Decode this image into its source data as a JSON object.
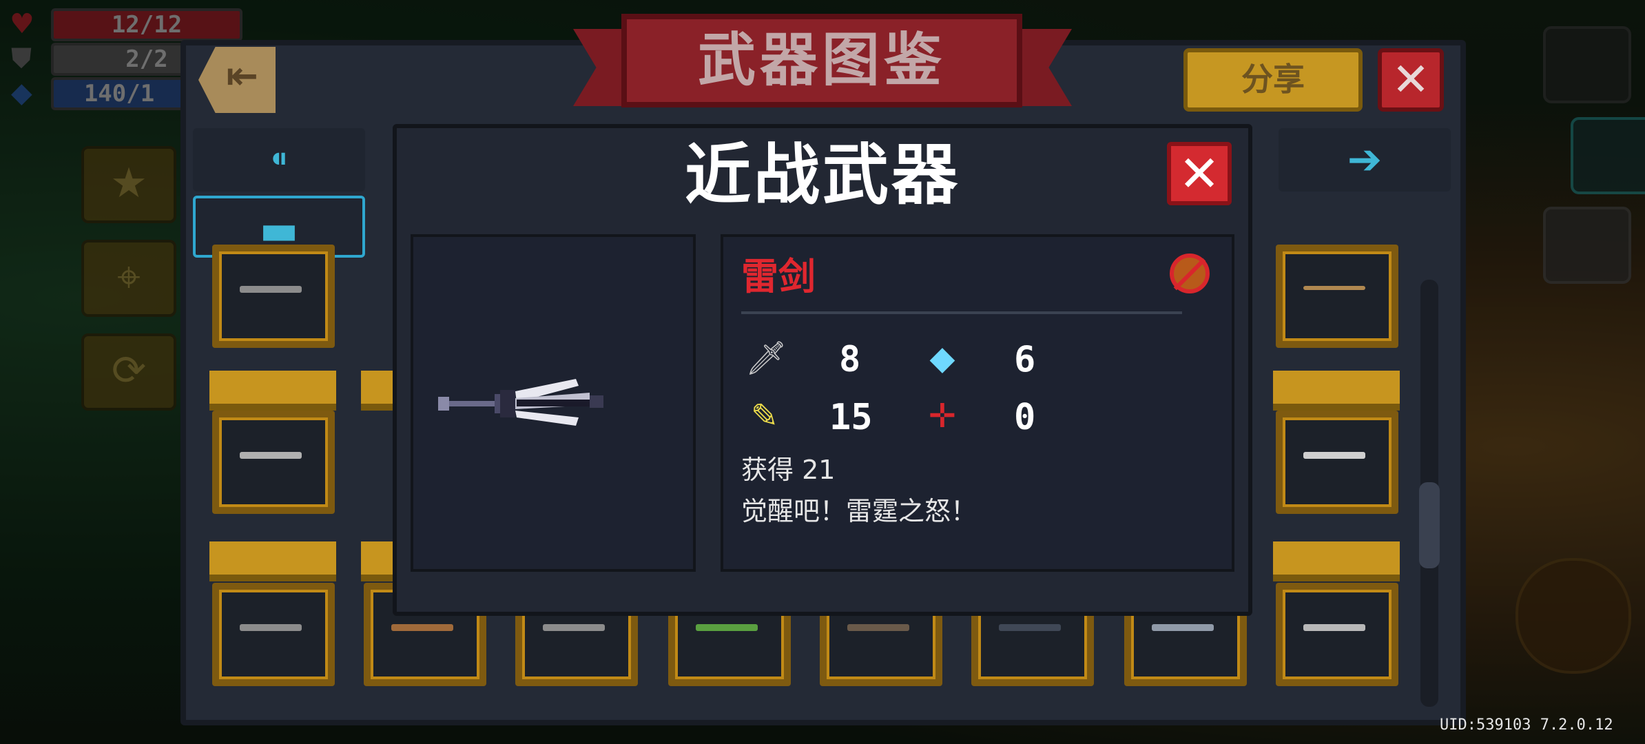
{
  "hud": {
    "health": "12/12",
    "armor": "2/2",
    "energy": "140/1",
    "colors": {
      "health": "#b3262c",
      "armor": "#6b6b6b",
      "energy": "#2d5fa8"
    }
  },
  "codex": {
    "title": "武器图鉴",
    "share_label": "分享",
    "close_glyph": "✕",
    "back_glyph": "⇤"
  },
  "modal": {
    "title": "近战武器",
    "close_glyph": "✕",
    "weapon_name": "雷剑",
    "stats": {
      "damage": "8",
      "energy": "6",
      "critical": "15",
      "spread": "0"
    },
    "obtained": "获得 21",
    "quote": "觉醒吧！雷霆之怒！"
  },
  "footer": {
    "uid": "UID:539103 7.2.0.12"
  },
  "icons": {
    "damage": "sword-icon",
    "energy": "diamond-icon",
    "critical": "feather-icon",
    "spread": "crosshair-icon"
  }
}
